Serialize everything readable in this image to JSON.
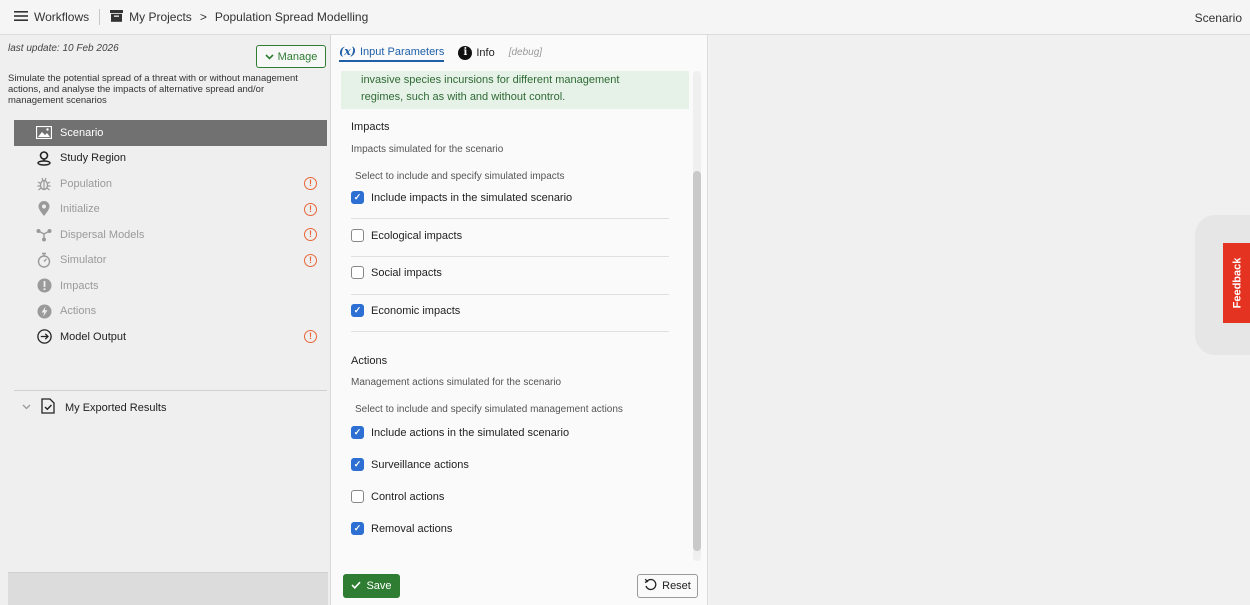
{
  "topbar": {
    "workflows": "Workflows",
    "projects": "My Projects",
    "project_name": "Population Spread Modelling",
    "right_label": "Scenario"
  },
  "left": {
    "last_update": "last update: 10 Feb 2026",
    "manage": "Manage",
    "description": "Simulate the potential spread of a threat with or without management actions, and analyse the impacts of alternative spread and/or management scenarios",
    "nav": [
      {
        "label": "Scenario",
        "icon": "image-icon",
        "state": "active",
        "warning": false
      },
      {
        "label": "Study Region",
        "icon": "map-pin-icon",
        "state": "normal",
        "warning": false
      },
      {
        "label": "Population",
        "icon": "bug-icon",
        "state": "dim",
        "warning": true
      },
      {
        "label": "Initialize",
        "icon": "location-icon",
        "state": "dim",
        "warning": true
      },
      {
        "label": "Dispersal Models",
        "icon": "network-icon",
        "state": "dim",
        "warning": true
      },
      {
        "label": "Simulator",
        "icon": "timer-icon",
        "state": "dim",
        "warning": true
      },
      {
        "label": "Impacts",
        "icon": "alert-icon",
        "state": "dim",
        "warning": false
      },
      {
        "label": "Actions",
        "icon": "lightning-icon",
        "state": "dim",
        "warning": false
      },
      {
        "label": "Model Output",
        "icon": "arrow-circle-icon",
        "state": "normal",
        "warning": true
      }
    ],
    "exported": "My Exported Results"
  },
  "mid": {
    "tab_params": "Input Parameters",
    "tab_params_prefix": "(x)",
    "tab_info": "Info",
    "tab_debug": "[debug]",
    "green_line1": "invasive species incursions for different management",
    "green_line2": "regimes, such as with and without control.",
    "impacts": {
      "title": "Impacts",
      "subtitle": "Impacts simulated for the scenario",
      "help": "Select to include and specify simulated impacts",
      "include": {
        "label": "Include impacts in the simulated scenario",
        "checked": true
      },
      "items": [
        {
          "label": "Ecological impacts",
          "checked": false
        },
        {
          "label": "Social impacts",
          "checked": false
        },
        {
          "label": "Economic impacts",
          "checked": true
        }
      ]
    },
    "actions": {
      "title": "Actions",
      "subtitle": "Management actions simulated for the scenario",
      "help": "Select to include and specify simulated management actions",
      "include": {
        "label": "Include actions in the simulated scenario",
        "checked": true
      },
      "items": [
        {
          "label": "Surveillance actions",
          "checked": true
        },
        {
          "label": "Control actions",
          "checked": false
        },
        {
          "label": "Removal actions",
          "checked": true
        }
      ]
    },
    "save": "Save",
    "reset": "Reset"
  },
  "feedback": "Feedback",
  "colors": {
    "accent": "#2e7d32",
    "link": "#1f5fa8",
    "warning": "#e8663a",
    "feedback": "#e53322",
    "checkbox": "#2d6fd2"
  }
}
